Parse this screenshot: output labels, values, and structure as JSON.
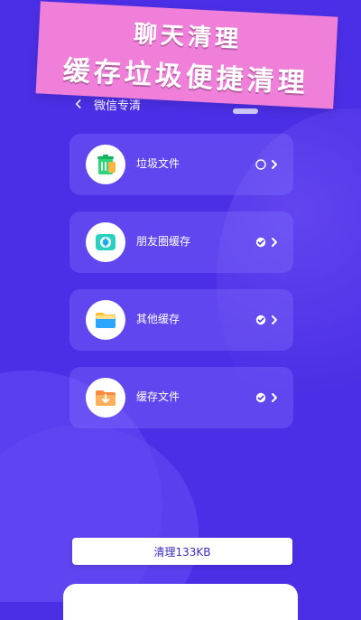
{
  "banner": {
    "line1": "聊天清理",
    "line2": "缓存垃圾便捷清理"
  },
  "header": {
    "title": "微信专清"
  },
  "items": [
    {
      "label": "垃圾文件",
      "selected": false,
      "icon": "trash-bin-icon"
    },
    {
      "label": "朋友圈缓存",
      "selected": true,
      "icon": "moments-camera-icon"
    },
    {
      "label": "其他缓存",
      "selected": true,
      "icon": "folder-icon"
    },
    {
      "label": "缓存文件",
      "selected": true,
      "icon": "download-folder-icon"
    }
  ],
  "action": {
    "clean_label": "清理133KB"
  },
  "colors": {
    "background": "#4b2fe6",
    "banner": "#f07fd9",
    "card": "#8773ff",
    "button_text": "#3a2bbd"
  }
}
